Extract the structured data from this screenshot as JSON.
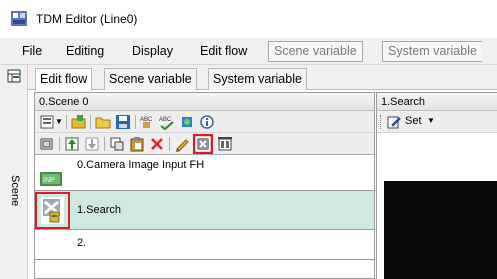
{
  "window": {
    "title": "TDM Editor (Line0)"
  },
  "menubar": {
    "items": [
      "File",
      "Editing",
      "Display",
      "Edit flow"
    ],
    "boxed_items": [
      "Scene variable",
      "System variable"
    ]
  },
  "side_strip": {
    "label": "Scene"
  },
  "tabs": [
    "Edit flow",
    "Scene variable",
    "System variable"
  ],
  "flow_panel": {
    "header": "0.Scene 0",
    "rows": [
      {
        "label": "0.Camera Image Input FH"
      },
      {
        "label": "1.Search"
      },
      {
        "label": "2."
      }
    ]
  },
  "right_panel": {
    "header": "1.Search",
    "set_label": "Set",
    "set_arrow": "▼"
  },
  "colors": {
    "selected_row": "#cfe8e0",
    "highlight_box": "#d32027",
    "menu_bg": "#f0f0f0"
  },
  "icons": [
    "app-icon",
    "scene-strip-icon",
    "new-icon",
    "dropdown-arrow-icon",
    "open-folder-icon",
    "save-icon",
    "spellcheck-icon",
    "settings-icon",
    "info-icon",
    "copy-icon",
    "move-icon",
    "cut-icon",
    "paste-icon",
    "delete-icon",
    "edit-icon",
    "close-box-icon",
    "property-icon",
    "camera-input-icon",
    "search-icon",
    "set-icon"
  ]
}
